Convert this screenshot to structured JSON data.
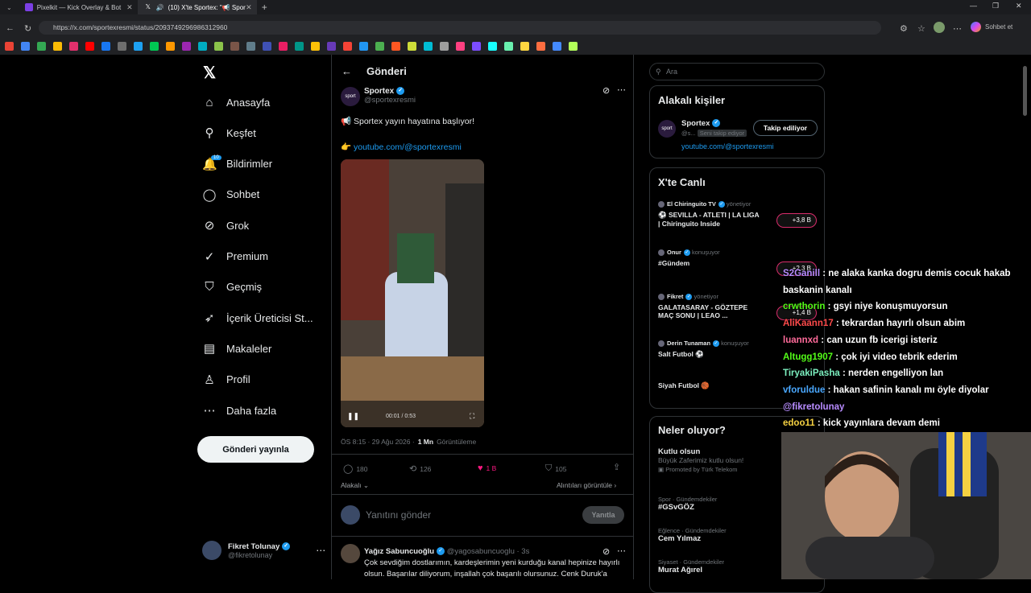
{
  "browser": {
    "tabs": [
      {
        "title": "Pixelkit — Kick Overlay & Bot",
        "icon": "pixelkit-icon",
        "color": "#7b3fe4"
      },
      {
        "title": "(10) X'te Sportex: \"📢 Sporte",
        "icon": "x-logo-icon",
        "color": "#ffffff"
      }
    ],
    "url": "https://x.com/sportexresmi/status/2093749296986312960",
    "profile_label": "Sohbet et",
    "bookmark_colors": [
      "#ea4335",
      "#4285f4",
      "#34a853",
      "#fbbc05",
      "#e1306c",
      "#ff0000",
      "#1877f2",
      "#6e6e6e",
      "#1da1f2",
      "#00c853",
      "#ff9800",
      "#9c27b0",
      "#00acc1",
      "#8bc34a",
      "#795548",
      "#607d8b",
      "#3f51b5",
      "#e91e63",
      "#009688",
      "#ffc107",
      "#673ab7",
      "#f44336",
      "#2196f3",
      "#4caf50",
      "#ff5722",
      "#cddc39",
      "#00bcd4",
      "#9e9e9e",
      "#ff4081",
      "#7c4dff",
      "#18ffff",
      "#69f0ae",
      "#ffd740",
      "#ff6e40",
      "#448aff",
      "#b2ff59"
    ]
  },
  "nav": {
    "items": [
      {
        "label": "Anasayfa",
        "icon": "home-icon",
        "glyph": "⌂"
      },
      {
        "label": "Keşfet",
        "icon": "search-icon",
        "glyph": "⚲"
      },
      {
        "label": "Bildirimler",
        "icon": "bell-icon",
        "glyph": "🔔",
        "badge": "10"
      },
      {
        "label": "Sohbet",
        "icon": "chat-icon",
        "glyph": "◯"
      },
      {
        "label": "Grok",
        "icon": "grok-icon",
        "glyph": "⊘"
      },
      {
        "label": "Premium",
        "icon": "premium-icon",
        "glyph": "✓"
      },
      {
        "label": "Geçmiş",
        "icon": "bookmark-icon",
        "glyph": "⛉"
      },
      {
        "label": "İçerik Üreticisi St...",
        "icon": "rocket-icon",
        "glyph": "➶"
      },
      {
        "label": "Makaleler",
        "icon": "article-icon",
        "glyph": "▤"
      },
      {
        "label": "Profil",
        "icon": "profile-icon",
        "glyph": "♙"
      },
      {
        "label": "Daha fazla",
        "icon": "more-icon",
        "glyph": "⋯"
      }
    ],
    "post_button": "Gönderi yayınla",
    "me": {
      "name": "Fikret Tolunay",
      "handle": "@fikretolunay"
    }
  },
  "post": {
    "header": "Gönderi",
    "author": "Sportex",
    "handle": "@sportexresmi",
    "text": "📢 Sportex yayın hayatına başlıyor!",
    "link_emoji": "👉",
    "link": "youtube.com/@sportexresmi",
    "time": "ÖS 8:15 · 29 Ağu 2026 ·",
    "views_count": "1 Mn",
    "views_label": "Görüntüleme",
    "replies": "180",
    "reposts": "126",
    "likes": "1 B",
    "bookmarks": "105",
    "relevance": "Alakalı",
    "quotes": "Alıntıları görüntüle",
    "reply_placeholder": "Yanıtını gönder",
    "reply_button": "Yanıtla",
    "video_time": "00:01 / 0:53"
  },
  "reply": {
    "author": "Yağız Sabuncuoğlu",
    "handle": "@yagosabuncuoglu · 3s",
    "text1": "Çok sevdiğim dostlarımın, kardeşlerimin yeni kurduğu kanal hepinize hayırlı",
    "text2": "olsun. Başarılar diliyorum, inşallah çok başarılı olursunuz. Cenk Duruk'a"
  },
  "right": {
    "search_placeholder": "Ara",
    "related_title": "Alakalı kişiler",
    "related": {
      "name": "Sportex",
      "handle": "@s...",
      "follows_you": "Seni takip ediyor",
      "follow_button": "Takip ediliyor",
      "link": "youtube.com/@sportexresmi"
    },
    "live_title": "X'te Canlı",
    "live": [
      {
        "host": "El Chiringuito TV",
        "role": "yönetiyor",
        "title1": "⚽ SEVILLA - ATLETI | LA LIGA",
        "title2": "| Chiringuito Inside",
        "count": "+3,8 B"
      },
      {
        "host": "Onur",
        "role": "konuşuyor",
        "title1": "#Gündem",
        "title2": "",
        "count": "+2,3 B"
      },
      {
        "host": "Fikret",
        "role": "yönetiyor",
        "title1": "GALATASARAY - GÖZTEPE",
        "title2": "MAÇ SONU | LEAO ...",
        "count": "+1,4 B"
      },
      {
        "host": "Derin Tunaman",
        "role": "konuşuyor",
        "title1": "Salt Futbol ⚽",
        "title2": "",
        "count": ""
      },
      {
        "host": "",
        "role": "",
        "title1": "Siyah Futbol 🏀",
        "title2": "",
        "count": ""
      }
    ],
    "trends_title": "Neler oluyor?",
    "trends": [
      {
        "meta": "",
        "title": "Kutlu olsun",
        "sub": "Büyük Zaferimiz kutlu olsun!",
        "promo": "Promoted by Türk Telekom"
      },
      {
        "meta": "Spor · Gündemdekiler",
        "title": "#GSvGÖZ",
        "sub": "",
        "promo": ""
      },
      {
        "meta": "Eğlence · Gündemdekiler",
        "title": "Cem Yılmaz",
        "sub": "",
        "promo": ""
      },
      {
        "meta": "Siyaset · Gündemdekiler",
        "title": "Murat Ağırel",
        "sub": "",
        "promo": ""
      }
    ]
  },
  "chat": [
    {
      "user": "S2Ganill",
      "msg": " : ne alaka kanka dogru demis cocuk hakab",
      "color": "#b88cff"
    },
    {
      "user": "",
      "msg": "baskanin kanalı",
      "color": "#ffffff"
    },
    {
      "user": "crwthorin",
      "msg": " : gsyi niye konuşmuyorsun",
      "color": "#53fc18"
    },
    {
      "user": "AliKaann17",
      "msg": " : tekrardan hayırlı olsun abim",
      "color": "#ff4b4b"
    },
    {
      "user": "luannxd",
      "msg": " : can uzun fb icerigi isteriz",
      "color": "#ff6b9a"
    },
    {
      "user": "Altugg1907",
      "msg": " : çok iyi video tebrik ederim",
      "color": "#53fc18"
    },
    {
      "user": "TiryakiPasha",
      "msg": " : nerden engelliyon lan",
      "color": "#7cf0c0"
    },
    {
      "user": "vforuldue",
      "msg": " : hakan safinin kanalı mı öyle diyolar",
      "color": "#4aa8ff"
    },
    {
      "user": "",
      "msg": "@fikretolunay",
      "color": "#b88cff"
    },
    {
      "user": "edoo11",
      "msg": " : kick yayınlara devam demi",
      "color": "#f5d142"
    }
  ]
}
